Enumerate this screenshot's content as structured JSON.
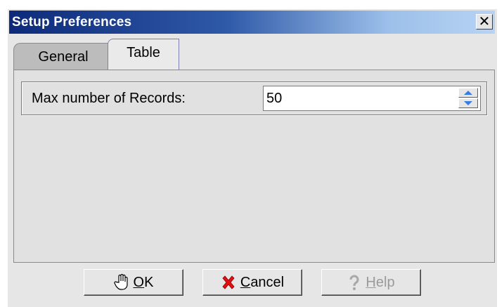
{
  "window": {
    "title": "Setup Preferences",
    "close_icon": "close-icon"
  },
  "tabs": [
    {
      "label": "General",
      "selected": false
    },
    {
      "label": "Table",
      "selected": true
    }
  ],
  "settings": {
    "max_records_label": "Max number of Records:",
    "max_records_value": "50"
  },
  "buttons": {
    "ok": {
      "mnemonic": "O",
      "rest": "K",
      "icon": "hand-icon"
    },
    "cancel": {
      "mnemonic": "C",
      "rest": "ancel",
      "icon": "x-icon"
    },
    "help": {
      "mnemonic": "H",
      "rest": "elp",
      "icon": "question-icon",
      "enabled": false
    }
  },
  "colors": {
    "title_start": "#0d2a7a",
    "title_end": "#b7d3f3",
    "accent": "#3a7be0",
    "cancel_red": "#e01010"
  }
}
